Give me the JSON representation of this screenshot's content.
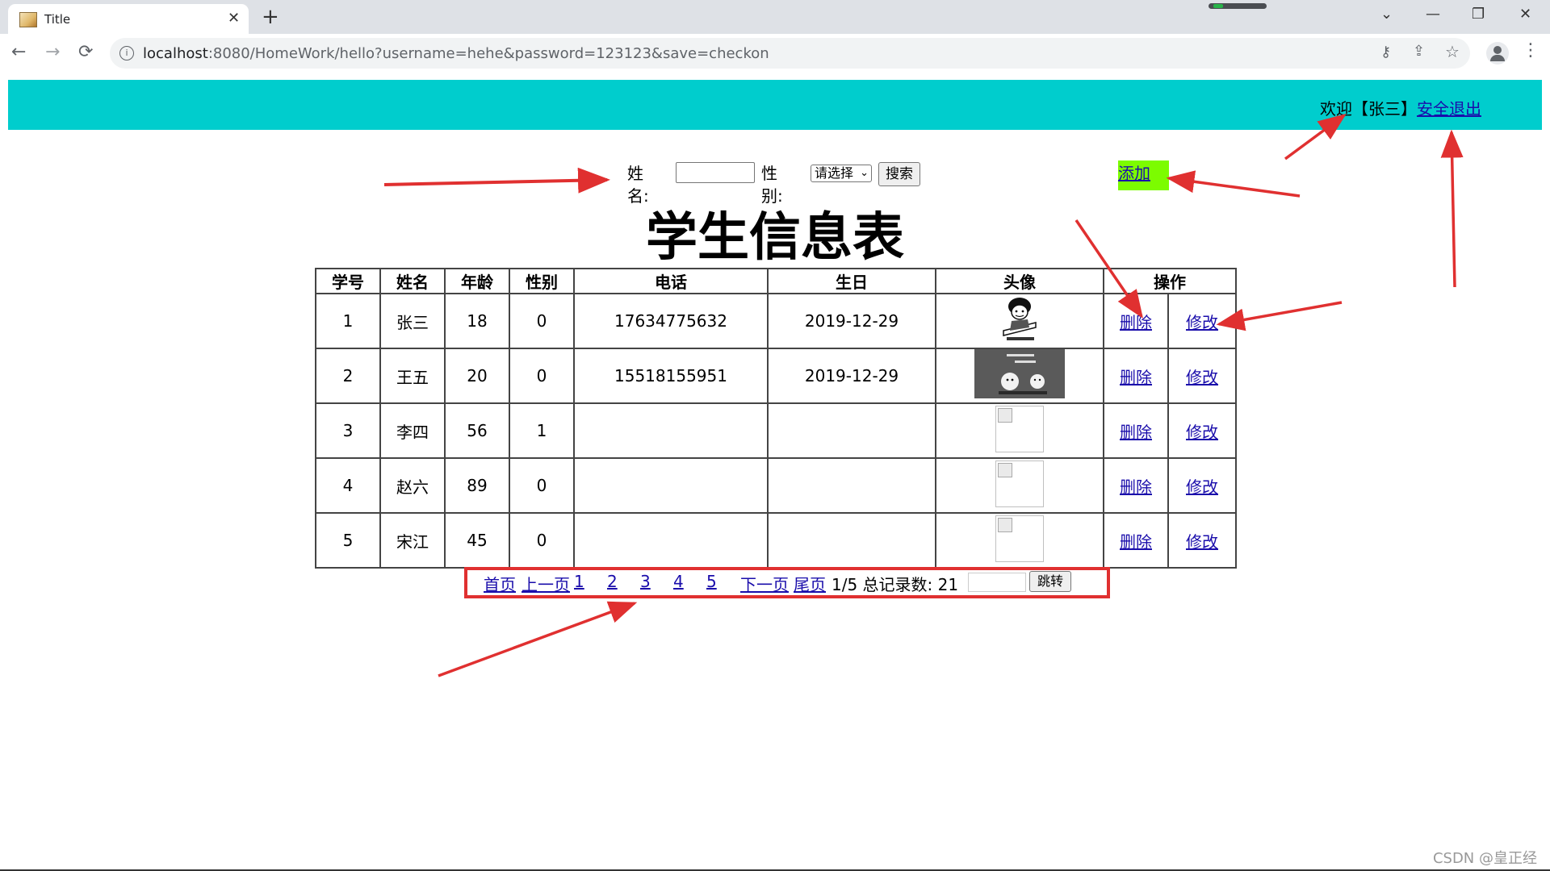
{
  "browser": {
    "tab_title": "Title",
    "tab_close": "✕",
    "new_tab": "+",
    "url_host": "localhost",
    "url_rest": ":8080/HomeWork/hello?username=hehe&password=123123&save=checkon",
    "window": {
      "chevron": "⌄",
      "minimize": "—",
      "maximize": "❐",
      "close": "✕"
    },
    "nav": {
      "back": "←",
      "forward": "→",
      "reload": "⟳"
    },
    "icons": {
      "info": "i",
      "key": "⚷",
      "share": "⇪",
      "star": "☆",
      "menu": "⋮"
    }
  },
  "header": {
    "welcome_text": "欢迎【张三】",
    "logout_label": "安全退出",
    "banner_color": "#00cdcd"
  },
  "search": {
    "name_label": "姓名:",
    "name_value": "",
    "gender_label": "性别:",
    "gender_selected": "请选择",
    "search_button": "搜索"
  },
  "add": {
    "label": "添加",
    "color": "#7cfc00"
  },
  "title": "学生信息表",
  "table": {
    "headers": [
      "学号",
      "姓名",
      "年龄",
      "性别",
      "电话",
      "生日",
      "头像",
      "操作"
    ],
    "delete_label": "删除",
    "edit_label": "修改",
    "rows": [
      {
        "id": "1",
        "name": "张三",
        "age": "18",
        "gender": "0",
        "phone": "17634775632",
        "birthday": "2019-12-29",
        "avatar": "meme"
      },
      {
        "id": "2",
        "name": "王五",
        "age": "20",
        "gender": "0",
        "phone": "15518155951",
        "birthday": "2019-12-29",
        "avatar": "meme"
      },
      {
        "id": "3",
        "name": "李四",
        "age": "56",
        "gender": "1",
        "phone": "",
        "birthday": "",
        "avatar": "broken-image"
      },
      {
        "id": "4",
        "name": "赵六",
        "age": "89",
        "gender": "0",
        "phone": "",
        "birthday": "",
        "avatar": "broken-image"
      },
      {
        "id": "5",
        "name": "宋江",
        "age": "45",
        "gender": "0",
        "phone": "",
        "birthday": "",
        "avatar": "broken-image"
      }
    ]
  },
  "pagination": {
    "first": "首页",
    "prev": "上一页",
    "pages": [
      "1",
      "2",
      "3",
      "4",
      "5"
    ],
    "next": "下一页",
    "last": "尾页",
    "status": "1/5 总记录数:  21",
    "jump_button": "跳转",
    "jump_value": ""
  },
  "watermark": "CSDN @皇正经",
  "annotation_color": "#e03030"
}
